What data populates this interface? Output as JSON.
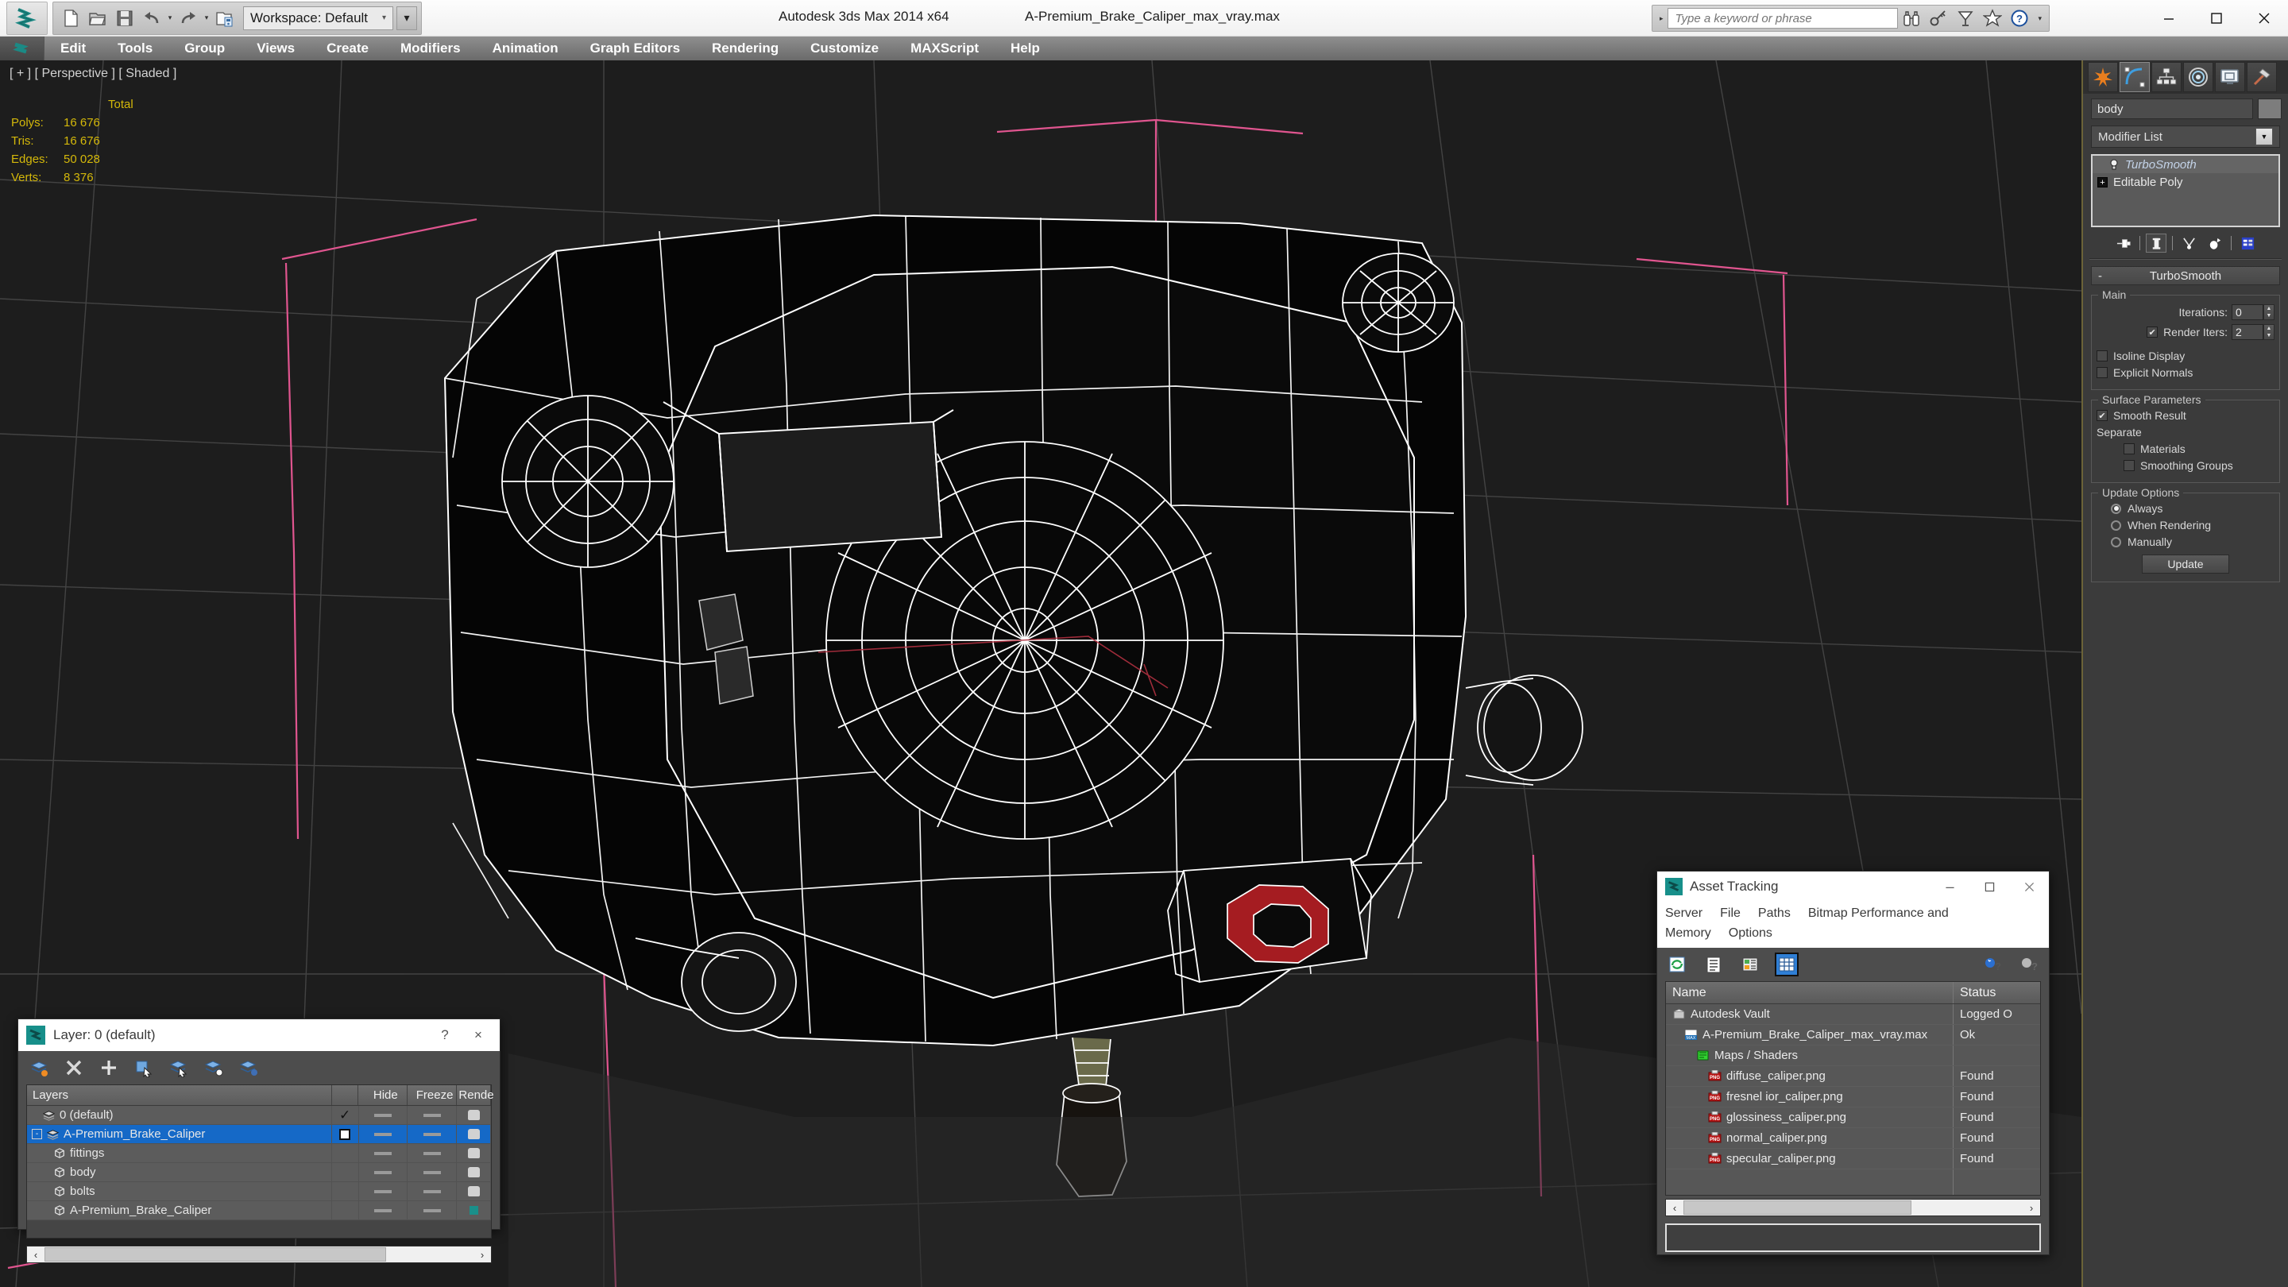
{
  "titlebar": {
    "app_title": "Autodesk 3ds Max  2014 x64",
    "file_title": "A-Premium_Brake_Caliper_max_vray.max",
    "workspace_label": "Workspace: Default",
    "search_placeholder": "Type a keyword or phrase",
    "quick_access": [
      {
        "name": "new-file",
        "label": "New"
      },
      {
        "name": "open-file",
        "label": "Open"
      },
      {
        "name": "save-file",
        "label": "Save"
      },
      {
        "name": "undo",
        "label": "Undo"
      },
      {
        "name": "redo",
        "label": "Redo"
      },
      {
        "name": "set-project-folder",
        "label": "Set Project Folder"
      }
    ],
    "search_icons": [
      "binoculars-icon",
      "key-icon",
      "satellite-icon",
      "star-icon",
      "help-icon"
    ],
    "window_controls": [
      "minimize",
      "maximize",
      "close"
    ]
  },
  "menubar": {
    "items": [
      "Edit",
      "Tools",
      "Group",
      "Views",
      "Create",
      "Modifiers",
      "Animation",
      "Graph Editors",
      "Rendering",
      "Customize",
      "MAXScript",
      "Help"
    ]
  },
  "viewport": {
    "label": "[ + ] [ Perspective ] [ Shaded ]",
    "stats": {
      "header": "Total",
      "rows": [
        {
          "label": "Polys:",
          "value": "16 676"
        },
        {
          "label": "Tris:",
          "value": "16 676"
        },
        {
          "label": "Edges:",
          "value": "50 028"
        },
        {
          "label": "Verts:",
          "value": "8 376"
        }
      ]
    },
    "stat_color": "#d4b80a",
    "background": "#1d1d1d",
    "wire_color": "#ffffff",
    "grid_color": "#4a4a4a",
    "axis_color": "#e0558f",
    "accent_red": "#b01f24"
  },
  "command_panel": {
    "tabs": [
      {
        "name": "create-tab",
        "icon": "star-burst-icon",
        "active": false
      },
      {
        "name": "modify-tab",
        "icon": "curve-icon",
        "active": true
      },
      {
        "name": "hierarchy-tab",
        "icon": "hierarchy-icon",
        "active": false
      },
      {
        "name": "motion-tab",
        "icon": "wheel-icon",
        "active": false
      },
      {
        "name": "display-tab",
        "icon": "monitor-icon",
        "active": false
      },
      {
        "name": "utilities-tab",
        "icon": "hammer-icon",
        "active": false
      }
    ],
    "object_name": "body",
    "modifier_list_label": "Modifier List",
    "stack": [
      {
        "name": "TurboSmooth",
        "italic": true,
        "selected": true,
        "icon": "lightbulb-icon"
      },
      {
        "name": "Editable Poly",
        "italic": false,
        "selected": false,
        "icon": "plus-box-icon"
      }
    ],
    "stack_buttons": [
      "pin-stack-icon",
      "show-end-result-icon",
      "make-unique-icon",
      "remove-modifier-icon",
      "configure-modifier-sets-icon"
    ],
    "turbosmooth": {
      "title": "TurboSmooth",
      "minus": "-",
      "groups": {
        "main": {
          "title": "Main",
          "iterations_label": "Iterations:",
          "iterations_value": "0",
          "render_iters_label": "Render Iters:",
          "render_iters_value": "2",
          "render_iters_checked": true,
          "isoline_label": "Isoline Display",
          "isoline_checked": false,
          "explicit_label": "Explicit Normals",
          "explicit_checked": false
        },
        "surface": {
          "title": "Surface Parameters",
          "smooth_result_label": "Smooth Result",
          "smooth_result_checked": true,
          "separate_label": "Separate",
          "materials_label": "Materials",
          "materials_checked": false,
          "smoothing_groups_label": "Smoothing Groups",
          "smoothing_groups_checked": false
        },
        "update": {
          "title": "Update Options",
          "options": [
            {
              "label": "Always",
              "selected": true
            },
            {
              "label": "When Rendering",
              "selected": false
            },
            {
              "label": "Manually",
              "selected": false
            }
          ],
          "button_label": "Update"
        }
      }
    }
  },
  "layer_dialog": {
    "title": "Layer: 0 (default)",
    "help_label": "?",
    "close_label": "×",
    "toolbar": [
      "create-new-layer-icon",
      "delete-layer-icon",
      "add-to-layer-icon",
      "select-objects-in-layer-icon",
      "select-highlighted-objects-icon",
      "highlight-selected-objects-icon",
      "layer-properties-icon"
    ],
    "columns": [
      "Layers",
      "",
      "Hide",
      "Freeze",
      "Rende"
    ],
    "rows": [
      {
        "name": "0 (default)",
        "indent": 1,
        "icon": "layer-icon",
        "check": "✓",
        "selected": false,
        "render": "teapot"
      },
      {
        "name": "A-Premium_Brake_Caliper",
        "indent": 0,
        "icon": "layer-icon",
        "check": "box",
        "selected": true,
        "render": "teapot",
        "expander": "-"
      },
      {
        "name": "fittings",
        "indent": 2,
        "icon": "object-icon",
        "check": "",
        "selected": false,
        "render": "teapot"
      },
      {
        "name": "body",
        "indent": 2,
        "icon": "object-icon",
        "check": "",
        "selected": false,
        "render": "teapot"
      },
      {
        "name": "bolts",
        "indent": 2,
        "icon": "object-icon",
        "check": "",
        "selected": false,
        "render": "teapot"
      },
      {
        "name": "A-Premium_Brake_Caliper",
        "indent": 2,
        "icon": "object-icon",
        "check": "",
        "selected": false,
        "render": "teal"
      }
    ],
    "scroll_left": "‹",
    "scroll_right": "›"
  },
  "asset_dialog": {
    "title": "Asset Tracking",
    "menu": [
      "Server",
      "File",
      "Paths",
      "Bitmap Performance and Memory",
      "Options"
    ],
    "toolbar": [
      "refresh-icon",
      "list-view-icon",
      "detail-view-icon",
      "grid-view-icon"
    ],
    "toolbar_right": [
      "help-new-icon",
      "help-icon"
    ],
    "columns": [
      "Name",
      "Status"
    ],
    "rows": [
      {
        "name": "Autodesk Vault",
        "status": "Logged O",
        "indent": 0,
        "icon": "vault-icon"
      },
      {
        "name": "A-Premium_Brake_Caliper_max_vray.max",
        "status": "Ok",
        "indent": 1,
        "icon": "max-file-icon"
      },
      {
        "name": "Maps / Shaders",
        "status": "",
        "indent": 2,
        "icon": "maps-icon"
      },
      {
        "name": "diffuse_caliper.png",
        "status": "Found",
        "indent": 3,
        "icon": "png-icon"
      },
      {
        "name": "fresnel ior_caliper.png",
        "status": "Found",
        "indent": 3,
        "icon": "png-icon"
      },
      {
        "name": "glossiness_caliper.png",
        "status": "Found",
        "indent": 3,
        "icon": "png-icon"
      },
      {
        "name": "normal_caliper.png",
        "status": "Found",
        "indent": 3,
        "icon": "png-icon"
      },
      {
        "name": "specular_caliper.png",
        "status": "Found",
        "indent": 3,
        "icon": "png-icon"
      }
    ],
    "scroll_left": "‹",
    "scroll_right": "›"
  }
}
